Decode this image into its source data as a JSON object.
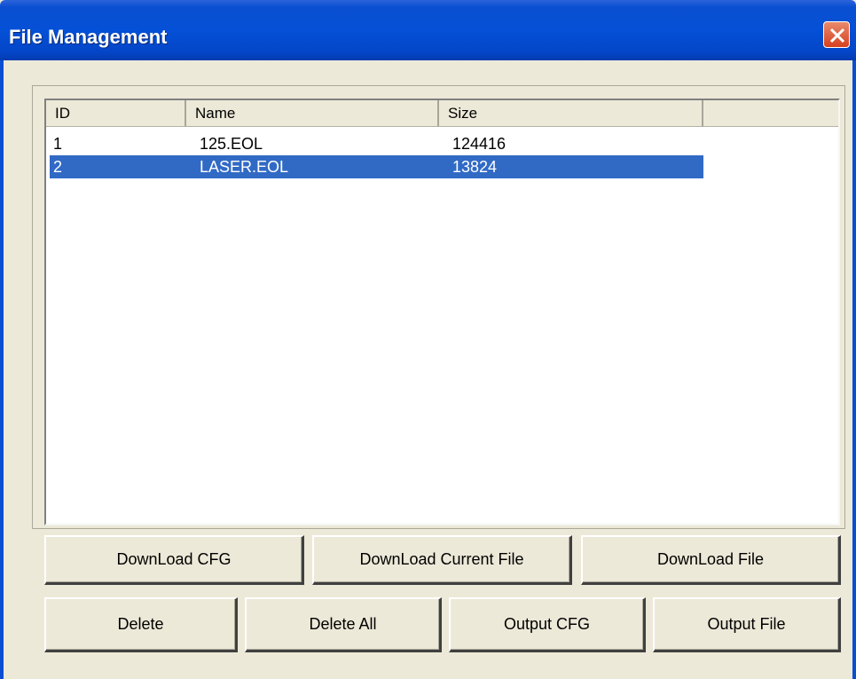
{
  "window": {
    "title": "File Management"
  },
  "listview": {
    "columns": [
      "ID",
      "Name",
      "Size"
    ],
    "rows": [
      {
        "id": "1",
        "name": "125.EOL",
        "size": "124416",
        "selected": false
      },
      {
        "id": "2",
        "name": "LASER.EOL",
        "size": "13824",
        "selected": true
      }
    ]
  },
  "buttons": {
    "download_cfg": "DownLoad CFG",
    "download_current_file": "DownLoad Current File",
    "download_file": "DownLoad File",
    "delete": "Delete",
    "delete_all": "Delete All",
    "output_cfg": "Output CFG",
    "output_file": "Output File"
  },
  "icons": {
    "close": "close-icon"
  },
  "colors": {
    "titlebar": "#0450d6",
    "selection": "#316ac5",
    "close": "#d6401f",
    "face": "#ece9d8"
  }
}
